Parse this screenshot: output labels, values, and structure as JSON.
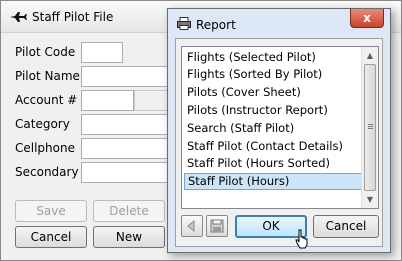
{
  "main_window": {
    "title": "Staff Pilot File",
    "fields": [
      {
        "label": "Pilot Code",
        "value": ""
      },
      {
        "label": "Pilot Name",
        "value": ""
      },
      {
        "label": "Account #",
        "value": ""
      },
      {
        "label": "Category",
        "value": ""
      },
      {
        "label": "Cellphone",
        "value": ""
      },
      {
        "label": "Secondary",
        "value": ""
      }
    ],
    "buttons": {
      "save": "Save",
      "delete": "Delete",
      "cancel": "Cancel",
      "new": "New"
    }
  },
  "report_dialog": {
    "title": "Report",
    "close_label": "x",
    "items": [
      "Flights (Selected Pilot)",
      "Flights (Sorted By Pilot)",
      "Pilots (Cover Sheet)",
      "Pilots (Instructor Report)",
      "Search (Staff Pilot)",
      "Staff Pilot (Contact Details)",
      "Staff Pilot (Hours Sorted)",
      "Staff Pilot (Hours)"
    ],
    "selected_item": "Staff Pilot (Hours)",
    "buttons": {
      "ok": "OK",
      "cancel": "Cancel"
    },
    "icons": [
      "back-arrow-icon",
      "save-disk-icon",
      "printer-icon"
    ]
  }
}
